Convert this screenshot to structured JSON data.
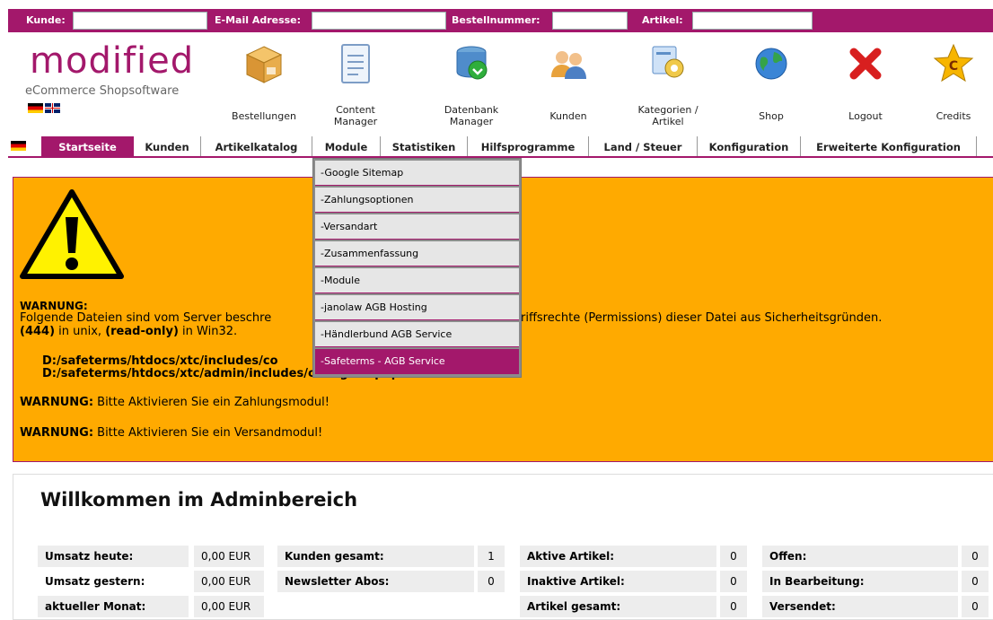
{
  "search": {
    "customer_label": "Kunde:",
    "email_label": "E-Mail Adresse:",
    "order_label": "Bestellnummer:",
    "article_label": "Artikel:"
  },
  "logo": {
    "brand": "modified",
    "tagline": "eCommerce Shopsoftware"
  },
  "toolbar": [
    {
      "label": "Bestellungen",
      "icon": "package-icon"
    },
    {
      "label": "Content\nManager",
      "icon": "document-icon"
    },
    {
      "label": "Datenbank\nManager",
      "icon": "database-icon"
    },
    {
      "label": "Kunden",
      "icon": "users-icon"
    },
    {
      "label": "Kategorien /\nArtikel",
      "icon": "category-icon"
    },
    {
      "label": "Shop",
      "icon": "globe-icon"
    },
    {
      "label": "Logout",
      "icon": "logout-x-icon"
    },
    {
      "label": "Credits",
      "icon": "credits-star-icon"
    }
  ],
  "nav": [
    "Startseite",
    "Kunden",
    "Artikelkatalog",
    "Module",
    "Statistiken",
    "Hilfsprogramme",
    "Land / Steuer",
    "Konfiguration",
    "Erweiterte Konfiguration"
  ],
  "dropdown": [
    "-Google Sitemap",
    "-Zahlungsoptionen",
    "-Versandart",
    "-Zusammenfassung",
    "-Module",
    "-janolaw AGB Hosting",
    "-Händlerbund AGB Service",
    "-Safeterms - AGB Service"
  ],
  "warning": {
    "title": "WARNUNG:",
    "line1a": "Folgende Dateien sind vom Server beschre",
    "line1b": "riffsrechte (Permissions) dieser Datei aus Sicherheitsgründen.",
    "line2_bold1": "(444)",
    "line2_text1": " in unix, ",
    "line2_bold2": "(read-only)",
    "line2_text2": " in Win32.",
    "file1": "D:/safeterms/htdocs/xtc/includes/co",
    "file2": "D:/safeterms/htdocs/xtc/admin/includes/configure.php",
    "payment_label": "WARNUNG:",
    "payment_text": " Bitte Aktivieren Sie ein Zahlungsmodul!",
    "shipping_label": "WARNUNG:",
    "shipping_text": " Bitte Aktivieren Sie ein Versandmodul!"
  },
  "welcome": {
    "title": "Willkommen im Adminbereich",
    "sales": [
      {
        "label": "Umsatz heute:",
        "value": "0,00 EUR"
      },
      {
        "label": "Umsatz gestern:",
        "value": "0,00 EUR"
      },
      {
        "label": "aktueller Monat:",
        "value": "0,00 EUR"
      }
    ],
    "customers": [
      {
        "label": "Kunden gesamt:",
        "value": "1"
      },
      {
        "label": "Newsletter Abos:",
        "value": "0"
      }
    ],
    "articles": [
      {
        "label": "Aktive Artikel:",
        "value": "0"
      },
      {
        "label": "Inaktive Artikel:",
        "value": "0"
      },
      {
        "label": "Artikel gesamt:",
        "value": "0"
      }
    ],
    "orders": [
      {
        "label": "Offen:",
        "value": "0"
      },
      {
        "label": "In Bearbeitung:",
        "value": "0"
      },
      {
        "label": "Versendet:",
        "value": "0"
      }
    ]
  },
  "colors": {
    "brand": "#a3186b",
    "warning_bg": "#ffaa00"
  }
}
